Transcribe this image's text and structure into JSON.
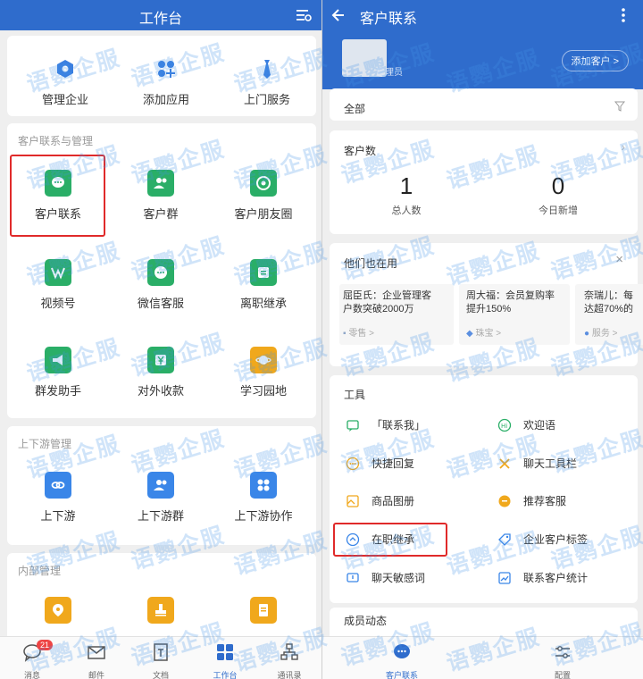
{
  "left": {
    "title": "工作台",
    "top_items": [
      "管理企业",
      "添加应用",
      "上门服务"
    ],
    "section1": {
      "label": "客户联系与管理",
      "items": [
        "客户联系",
        "客户群",
        "客户朋友圈",
        "视频号",
        "微信客服",
        "离职继承",
        "群发助手",
        "对外收款",
        "学习园地"
      ]
    },
    "section2": {
      "label": "上下游管理",
      "items": [
        "上下游",
        "上下游群",
        "上下游协作"
      ]
    },
    "section3": {
      "label": "内部管理"
    },
    "tabbar": {
      "items": [
        "消息",
        "邮件",
        "文档",
        "工作台",
        "通讯录"
      ],
      "badge": "21"
    }
  },
  "right": {
    "title": "客户联系",
    "admin_role": "管理员",
    "add_customer": "添加客户",
    "filter_label": "全部",
    "stats": {
      "label": "客户数",
      "total_value": "1",
      "total_label": "总人数",
      "new_value": "0",
      "new_label": "今日新增"
    },
    "others": {
      "label": "他们也在用",
      "cards": [
        {
          "line1": "屈臣氏：企业管理客",
          "line2": "户数突破2000万",
          "tag": "零售"
        },
        {
          "line1": "周大福：会员复购率",
          "line2": "提升150%",
          "tag": "珠宝"
        },
        {
          "line1": "奈瑞儿：每",
          "line2": "达超70%的",
          "tag": "服务"
        }
      ]
    },
    "tools": {
      "label": "工具",
      "items": [
        "「联系我」",
        "欢迎语",
        "快捷回复",
        "聊天工具栏",
        "商品图册",
        "推荐客服",
        "在职继承",
        "企业客户标签",
        "聊天敏感词",
        "联系客户统计"
      ]
    },
    "member_label": "成员动态",
    "tabbar": {
      "items": [
        "客户联系",
        "配置"
      ]
    }
  },
  "watermark": "语鹦企服",
  "colors": {
    "header": "#2f6ccc",
    "green": "#2aae67",
    "blue": "#3a86e8",
    "orange": "#f0a81c",
    "highlight": "#e02a2a"
  }
}
